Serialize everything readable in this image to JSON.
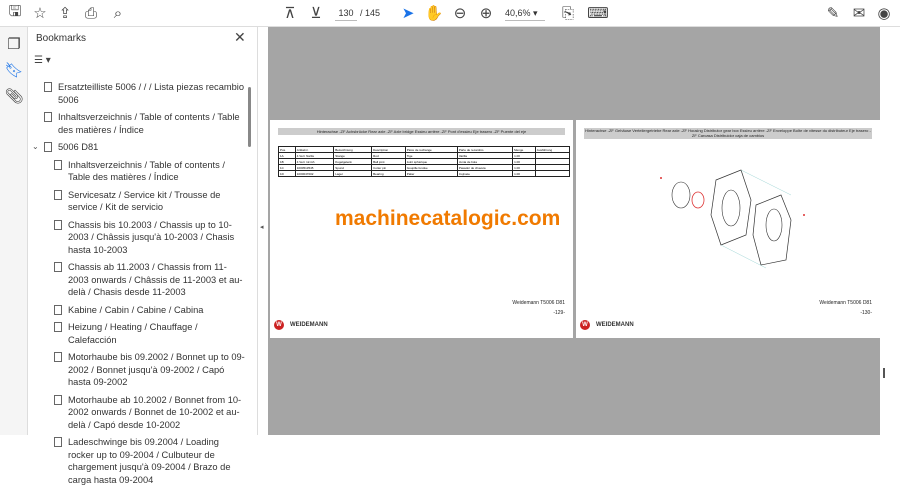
{
  "toolbar": {
    "page_current": "130",
    "page_total": "/ 145",
    "zoom": "40,6%"
  },
  "bookmarks": {
    "title": "Bookmarks",
    "items": [
      {
        "label": "Ersatzteilliste 5006 /  /  / Lista piezas recambio 5006",
        "level": 1
      },
      {
        "label": "Inhaltsverzeichnis / Table of contents / Table des matières / Índice",
        "level": 1
      },
      {
        "label": "5006 D81",
        "level": 0
      },
      {
        "label": "Inhaltsverzeichnis / Table of contents / Table des matières / Índice",
        "level": 2
      },
      {
        "label": "Servicesatz / Service kit / Trousse de service / Kit de servicio",
        "level": 2
      },
      {
        "label": "Chassis bis 10.2003 / Chassis up to 10-2003 / Châssis jusqu'à 10-2003 / Chasis hasta 10-2003",
        "level": 2
      },
      {
        "label": "Chassis ab 11.2003 / Chassis from 11-2003 onwards / Châssis de 11-2003 et au-delà / Chasis desde 11-2003",
        "level": 2
      },
      {
        "label": "Kabine / Cabin / Cabine / Cabina",
        "level": 2
      },
      {
        "label": "Heizung / Heating / Chauffage / Calefacción",
        "level": 2
      },
      {
        "label": "Motorhaube bis 09.2002 / Bonnet up to 09-2002 / Bonnet jusqu'à 09-2002 / Capó hasta 09-2002",
        "level": 2
      },
      {
        "label": "Motorhaube ab 10.2002 / Bonnet from 10-2002 onwards / Bonnet de 10-2002 et au-delà / Capó desde 10-2002",
        "level": 2
      },
      {
        "label": "Ladeschwinge bis 09.2004 / Loading rocker up to 09-2004 / Culbuteur de chargement jusqu'à 09-2004 / Brazo de carga hasta 09-2004",
        "level": 2
      }
    ]
  },
  "left_page": {
    "header": "Hinterachse -ZF Achsbrücke Rear axle -ZF Axle bridge Essieu arrière -ZF Pont d'essieu Eje trasero -ZF Puente del eje",
    "columns": [
      "Pos.",
      "Artikelnr.",
      "Bezeichnung",
      "Description",
      "Pièce de rechange",
      "Parte de recambio",
      "Menge",
      "Ausführung"
    ],
    "rows": [
      [
        "1A",
        "4 Verl. Na/3e",
        "Stange",
        "Rod",
        "Tige",
        "Varilla",
        "1.00",
        ""
      ],
      [
        "1B",
        "4 Verl. 12-Gh",
        "Kugelgelenk",
        "Ball joint",
        "Joint sphérique",
        "Junta de bola",
        "1.00",
        ""
      ],
      [
        "1C",
        "1000513545",
        "Spund",
        "Cotter pin",
        "Goupille fendue",
        "Pasador de chaveta",
        "1.00",
        ""
      ],
      [
        "1D",
        "1000047002",
        "Lager",
        "Bearing",
        "Palier",
        "Cojinete",
        "1.00",
        ""
      ]
    ],
    "brand": "WEIDEMANN",
    "model": "Weidemann T5006 D81",
    "page_no": "-129-"
  },
  "right_page": {
    "header": "Hinterachse -ZF Gehäuse Verteilergetriebe Rear axle -ZF Housing Distributor gear box Essieu arrière -ZF Enveloppe Boîte de vitesse du distributeur Eje trasero -ZF Carcasa Distribuidor caja de cambios",
    "brand": "WEIDEMANN",
    "model": "Weidemann T5006 D81",
    "page_no": "-130-"
  },
  "watermark": "machinecatalogic.com"
}
